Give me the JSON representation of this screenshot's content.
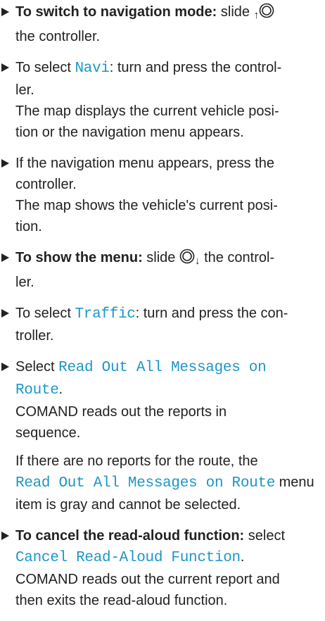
{
  "steps": [
    {
      "lead": "To switch to navigation mode:",
      "t1": "slide",
      "arrow": "↑",
      "t2": "the controller."
    },
    {
      "t1": "To select",
      "term": "Navi",
      "t2": ": turn and press the control-",
      "t3": "ler.",
      "r1": "The map displays the current vehicle posi-",
      "r2": "tion or the navigation menu appears."
    },
    {
      "t1": "If the navigation menu appears, press the",
      "t2": "controller.",
      "r1": "The map shows the vehicle's current posi-",
      "r2": "tion."
    },
    {
      "lead": "To show the menu:",
      "t1": "slide",
      "arrow": "↓",
      "t2": "the control-",
      "t3": "ler."
    },
    {
      "t1": "To select",
      "term": "Traffic",
      "t2": ": turn and press the con-",
      "t3": "troller."
    },
    {
      "t1": "Select",
      "term1": "Read Out All Messages on",
      "term2": "Route",
      "t2": ".",
      "r1": "COMAND reads out the reports in",
      "r2": "sequence.",
      "n1": "If there are no reports for the route, the",
      "nterm": "Read Out All Messages on Route",
      "n2": "menu",
      "n3": "item is gray and cannot be selected."
    },
    {
      "lead": "To cancel the read-aloud function:",
      "t1": "select",
      "term": "Cancel Read-Aloud Function",
      "t2": ".",
      "r1": "COMAND reads out the current report and",
      "r2": "then exits the read-aloud function."
    }
  ],
  "icons": {
    "bullet": "play-triangle-icon",
    "controller": "controller-knob-icon"
  },
  "colors": {
    "text": "#222222",
    "menu_term": "#1d96c8"
  }
}
